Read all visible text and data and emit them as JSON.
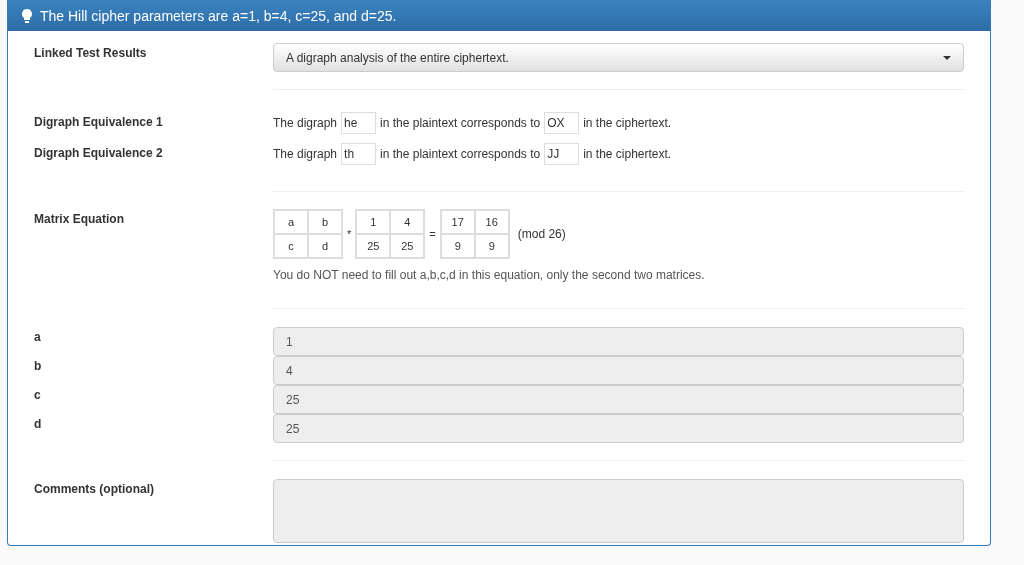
{
  "header": {
    "text": "The Hill cipher parameters are a=1, b=4, c=25, and d=25."
  },
  "linked_results": {
    "label": "Linked Test Results",
    "value": "A digraph analysis of the entire ciphertext."
  },
  "digraphs": [
    {
      "label": "Digraph Equivalence 1",
      "prefix": "The digraph",
      "plain": "he",
      "middle": "in the plaintext corresponds to",
      "cipher": "OX",
      "suffix": "in the ciphertext."
    },
    {
      "label": "Digraph Equivalence 2",
      "prefix": "The digraph",
      "plain": "th",
      "middle": "in the plaintext corresponds to",
      "cipher": "JJ",
      "suffix": "in the ciphertext."
    }
  ],
  "matrix_equation": {
    "label": "Matrix Equation",
    "matrix_1": [
      [
        "a",
        "b"
      ],
      [
        "c",
        "d"
      ]
    ],
    "op_1": "*",
    "matrix_2": [
      [
        "1",
        "4"
      ],
      [
        "25",
        "25"
      ]
    ],
    "op_2": "=",
    "matrix_3": [
      [
        "17",
        "16"
      ],
      [
        "9",
        "9"
      ]
    ],
    "modulus": "(mod 26)",
    "note": "You do NOT need to fill out a,b,c,d in this equation, only the second two matrices."
  },
  "parameters": [
    {
      "label": "a",
      "value": "1",
      "disabled": true
    },
    {
      "label": "b",
      "value": "4",
      "disabled": true
    },
    {
      "label": "c",
      "value": "25",
      "disabled": true
    },
    {
      "label": "d",
      "value": "25",
      "disabled": true
    }
  ],
  "comments": {
    "label": "Comments (optional)",
    "disabled": true
  }
}
